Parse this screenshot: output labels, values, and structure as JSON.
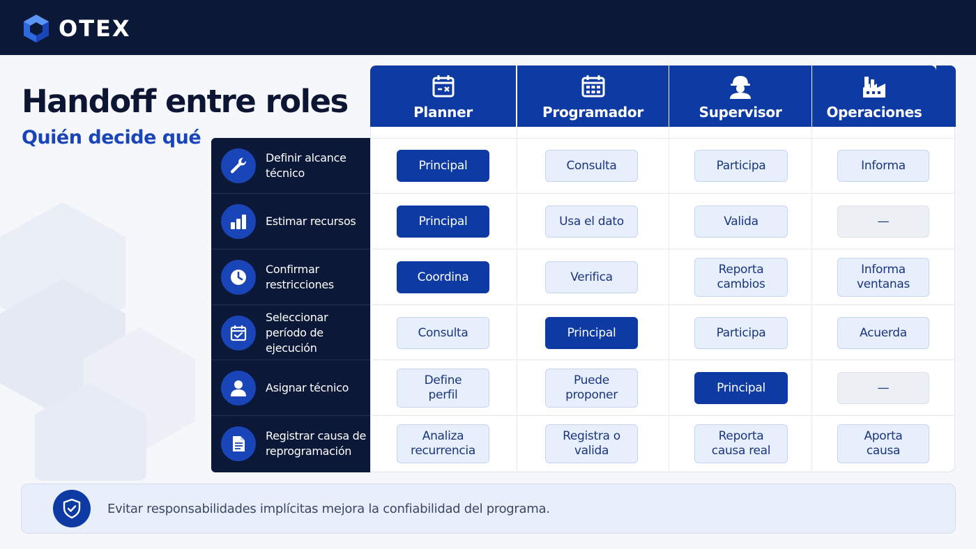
{
  "brand": {
    "name": "OTEX"
  },
  "title": "Handoff entre roles",
  "subtitle": "Quién decide qué",
  "roles": [
    {
      "label": "Planner",
      "icon": "calendar-icon"
    },
    {
      "label": "Programador",
      "icon": "calendar-grid-icon"
    },
    {
      "label": "Supervisor",
      "icon": "hard-hat-worker-icon"
    },
    {
      "label": "Operaciones",
      "icon": "factory-icon"
    }
  ],
  "tasks": [
    {
      "label": "Definir alcance técnico",
      "icon": "wrench-icon"
    },
    {
      "label": "Estimar recursos",
      "icon": "bar-chart-icon"
    },
    {
      "label": "Confirmar restricciones",
      "icon": "clock-icon"
    },
    {
      "label": "Seleccionar período de ejecución",
      "icon": "calendar-check-icon"
    },
    {
      "label": "Asignar técnico",
      "icon": "user-icon"
    },
    {
      "label": "Registrar causa de reprogramación",
      "icon": "document-icon"
    }
  ],
  "matrix": [
    [
      {
        "text": "Principal",
        "kind": "primary"
      },
      {
        "text": "Consulta",
        "kind": "secondary"
      },
      {
        "text": "Participa",
        "kind": "secondary"
      },
      {
        "text": "Informa",
        "kind": "secondary"
      }
    ],
    [
      {
        "text": "Principal",
        "kind": "primary"
      },
      {
        "text": "Usa el dato",
        "kind": "secondary"
      },
      {
        "text": "Valida",
        "kind": "secondary"
      },
      {
        "text": "—",
        "kind": "none"
      }
    ],
    [
      {
        "text": "Coordina",
        "kind": "primary"
      },
      {
        "text": "Verifica",
        "kind": "secondary"
      },
      {
        "text": "Reporta\ncambios",
        "kind": "secondary"
      },
      {
        "text": "Informa\nventanas",
        "kind": "secondary"
      }
    ],
    [
      {
        "text": "Consulta",
        "kind": "secondary"
      },
      {
        "text": "Principal",
        "kind": "primary"
      },
      {
        "text": "Participa",
        "kind": "secondary"
      },
      {
        "text": "Acuerda",
        "kind": "secondary"
      }
    ],
    [
      {
        "text": "Define\nperfil",
        "kind": "secondary"
      },
      {
        "text": "Puede\nproponer",
        "kind": "secondary"
      },
      {
        "text": "Principal",
        "kind": "primary"
      },
      {
        "text": "—",
        "kind": "none"
      }
    ],
    [
      {
        "text": "Analiza\nrecurrencia",
        "kind": "secondary"
      },
      {
        "text": "Registra o\nvalida",
        "kind": "secondary"
      },
      {
        "text": "Reporta\ncausa real",
        "kind": "secondary"
      },
      {
        "text": "Aporta\ncausa",
        "kind": "secondary"
      }
    ]
  ],
  "note": {
    "text": "Evitar responsabilidades implícitas mejora la confiabilidad del programa.",
    "icon": "shield-check-icon"
  },
  "colors": {
    "navy": "#0b1838",
    "primary": "#0d3aa3",
    "accent": "#1a45b8",
    "secondary_bg": "#e8effc"
  }
}
